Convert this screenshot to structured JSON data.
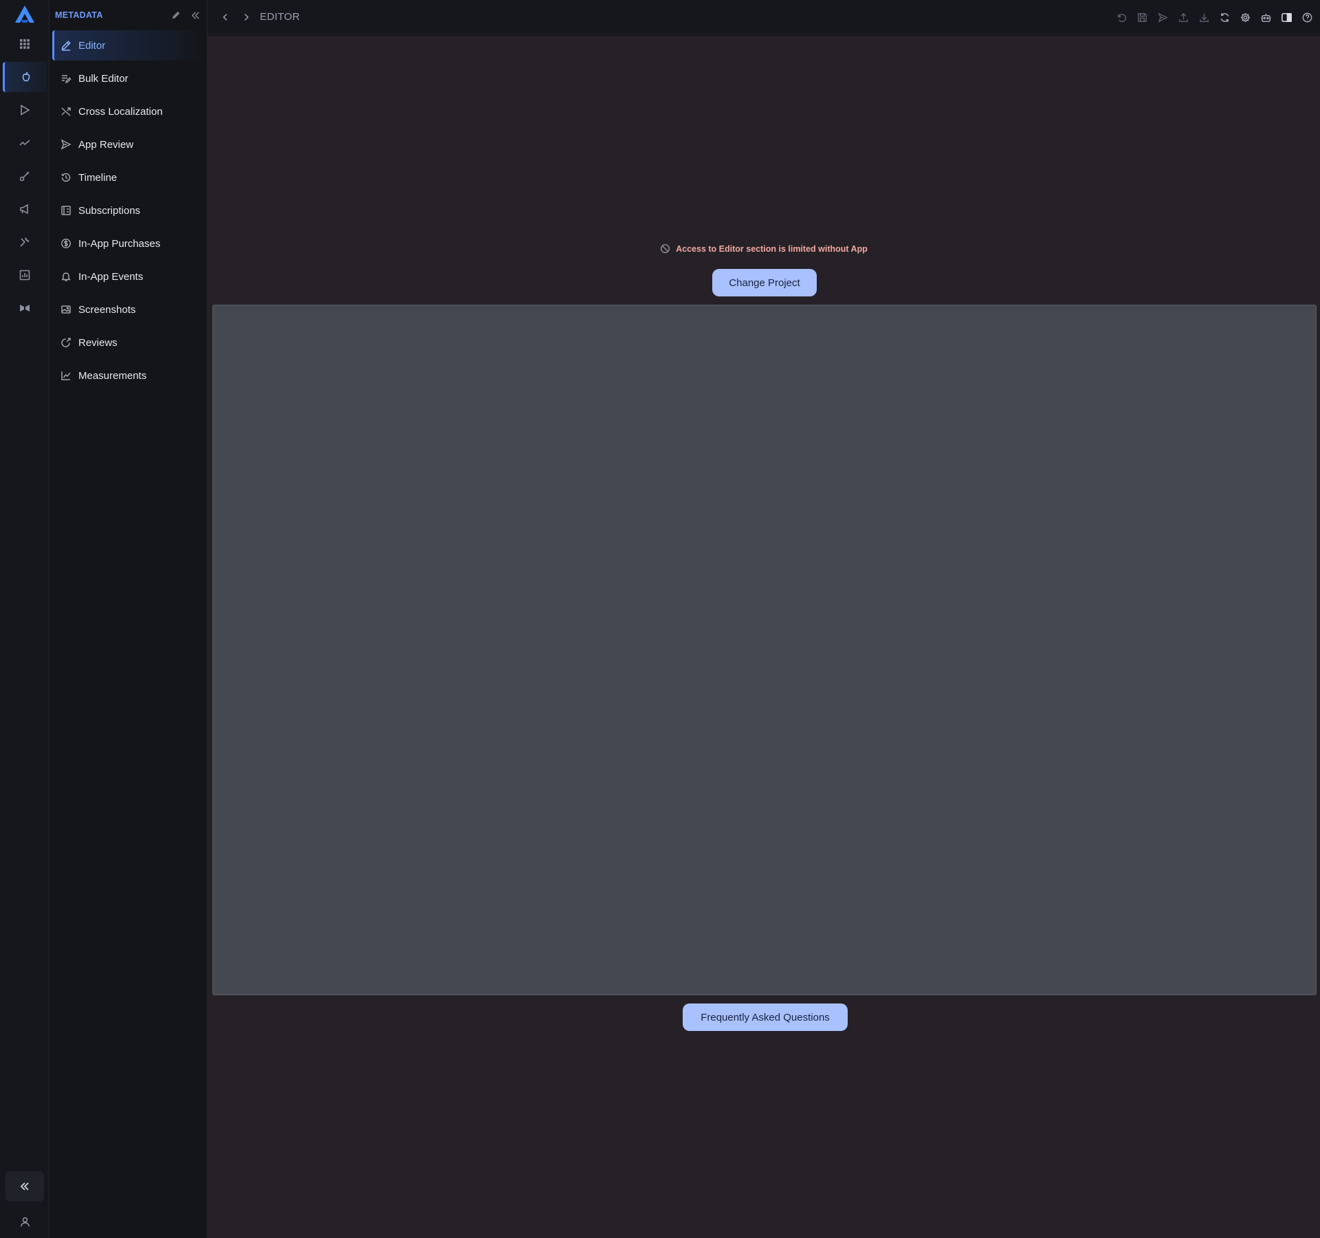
{
  "app": {
    "brand_color": "#3f8cff",
    "accent_color": "#5b8cff"
  },
  "rail": {
    "items": [
      {
        "icon": "grid-icon"
      },
      {
        "icon": "apple-icon",
        "active": true
      },
      {
        "icon": "play-store-icon"
      },
      {
        "icon": "trend-icon"
      },
      {
        "icon": "key-icon"
      },
      {
        "icon": "megaphone-icon"
      },
      {
        "icon": "tools-icon"
      },
      {
        "icon": "report-icon"
      },
      {
        "icon": "bowtie-icon"
      }
    ],
    "collapse_icon": "chevrons-left-icon",
    "user_icon": "user-icon"
  },
  "sidebar": {
    "title": "METADATA",
    "items": [
      {
        "label": "Editor",
        "icon": "pencil-icon",
        "active": true
      },
      {
        "label": "Bulk Editor",
        "icon": "bulk-edit-icon"
      },
      {
        "label": "Cross Localization",
        "icon": "shuffle-icon"
      },
      {
        "label": "App Review",
        "icon": "send-icon"
      },
      {
        "label": "Timeline",
        "icon": "history-icon"
      },
      {
        "label": "Subscriptions",
        "icon": "subscription-icon"
      },
      {
        "label": "In-App Purchases",
        "icon": "dollar-icon"
      },
      {
        "label": "In-App Events",
        "icon": "bell-icon"
      },
      {
        "label": "Screenshots",
        "icon": "image-icon"
      },
      {
        "label": "Reviews",
        "icon": "review-icon"
      },
      {
        "label": "Measurements",
        "icon": "chart-line-icon"
      }
    ]
  },
  "topbar": {
    "breadcrumb": "EDITOR",
    "tools": [
      "undo-icon",
      "save-icon",
      "send-icon",
      "upload-icon",
      "download-icon",
      "sync-icon",
      "settings-icon",
      "robot-icon",
      "panel-icon",
      "help-icon"
    ]
  },
  "main": {
    "notice": "Access to Editor section is limited without App",
    "change_project_label": "Change Project",
    "faq_label": "Frequently Asked Questions"
  }
}
